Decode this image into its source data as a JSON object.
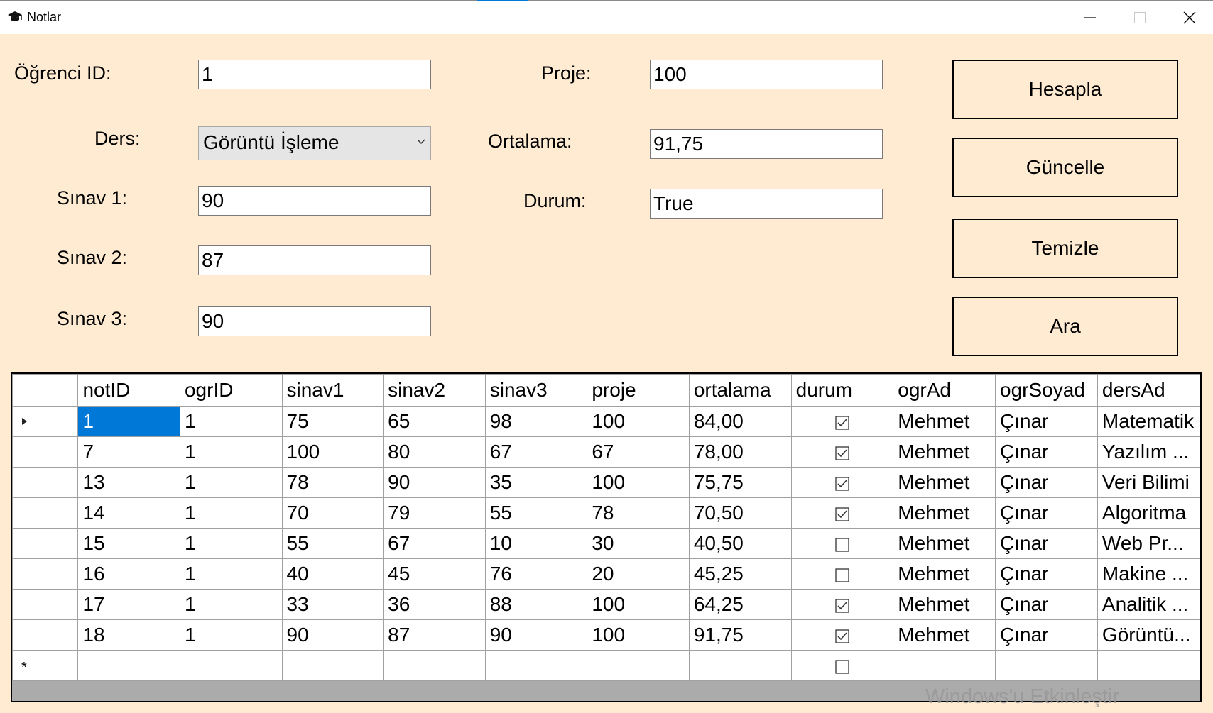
{
  "window": {
    "title": "Notlar",
    "icon": "graduation-cap-icon",
    "controls": [
      "minimize-icon",
      "maximize-icon",
      "close-icon"
    ]
  },
  "form": {
    "ogrenci_id": {
      "label": "Öğrenci ID:",
      "value": "1"
    },
    "ders": {
      "label": "Ders:",
      "value": "Görüntü İşleme"
    },
    "sinav1": {
      "label": "Sınav 1:",
      "value": "90"
    },
    "sinav2": {
      "label": "Sınav 2:",
      "value": "87"
    },
    "sinav3": {
      "label": "Sınav 3:",
      "value": "90"
    },
    "proje": {
      "label": "Proje:",
      "value": "100"
    },
    "ortalama": {
      "label": "Ortalama:",
      "value": "91,75"
    },
    "durum": {
      "label": "Durum:",
      "value": "True"
    }
  },
  "buttons": {
    "hesapla": "Hesapla",
    "guncelle": "Güncelle",
    "temizle": "Temizle",
    "ara": "Ara"
  },
  "grid": {
    "columns": [
      "notID",
      "ogrID",
      "sinav1",
      "sinav2",
      "sinav3",
      "proje",
      "ortalama",
      "durum",
      "ogrAd",
      "ogrSoyad",
      "dersAd"
    ],
    "rows": [
      {
        "notID": "1",
        "ogrID": "1",
        "sinav1": "75",
        "sinav2": "65",
        "sinav3": "98",
        "proje": "100",
        "ortalama": "84,00",
        "durum": true,
        "ogrAd": "Mehmet",
        "ogrSoyad": "Çınar",
        "dersAd": "Matematik"
      },
      {
        "notID": "7",
        "ogrID": "1",
        "sinav1": "100",
        "sinav2": "80",
        "sinav3": "67",
        "proje": "67",
        "ortalama": "78,00",
        "durum": true,
        "ogrAd": "Mehmet",
        "ogrSoyad": "Çınar",
        "dersAd": "Yazılım ..."
      },
      {
        "notID": "13",
        "ogrID": "1",
        "sinav1": "78",
        "sinav2": "90",
        "sinav3": "35",
        "proje": "100",
        "ortalama": "75,75",
        "durum": true,
        "ogrAd": "Mehmet",
        "ogrSoyad": "Çınar",
        "dersAd": "Veri Bilimi"
      },
      {
        "notID": "14",
        "ogrID": "1",
        "sinav1": "70",
        "sinav2": "79",
        "sinav3": "55",
        "proje": "78",
        "ortalama": "70,50",
        "durum": true,
        "ogrAd": "Mehmet",
        "ogrSoyad": "Çınar",
        "dersAd": "Algoritma"
      },
      {
        "notID": "15",
        "ogrID": "1",
        "sinav1": "55",
        "sinav2": "67",
        "sinav3": "10",
        "proje": "30",
        "ortalama": "40,50",
        "durum": false,
        "ogrAd": "Mehmet",
        "ogrSoyad": "Çınar",
        "dersAd": "Web Pr..."
      },
      {
        "notID": "16",
        "ogrID": "1",
        "sinav1": "40",
        "sinav2": "45",
        "sinav3": "76",
        "proje": "20",
        "ortalama": "45,25",
        "durum": false,
        "ogrAd": "Mehmet",
        "ogrSoyad": "Çınar",
        "dersAd": "Makine ..."
      },
      {
        "notID": "17",
        "ogrID": "1",
        "sinav1": "33",
        "sinav2": "36",
        "sinav3": "88",
        "proje": "100",
        "ortalama": "64,25",
        "durum": true,
        "ogrAd": "Mehmet",
        "ogrSoyad": "Çınar",
        "dersAd": "Analitik ..."
      },
      {
        "notID": "18",
        "ogrID": "1",
        "sinav1": "90",
        "sinav2": "87",
        "sinav3": "90",
        "proje": "100",
        "ortalama": "91,75",
        "durum": true,
        "ogrAd": "Mehmet",
        "ogrSoyad": "Çınar",
        "dersAd": "Görüntü..."
      }
    ],
    "selected_row": 0,
    "selected_column": "notID",
    "current_row_indicator": "row-arrow-icon",
    "new_row_indicator": "new-row-asterisk-icon"
  },
  "watermark": {
    "line1": "Windows'u Etkinleştir"
  }
}
